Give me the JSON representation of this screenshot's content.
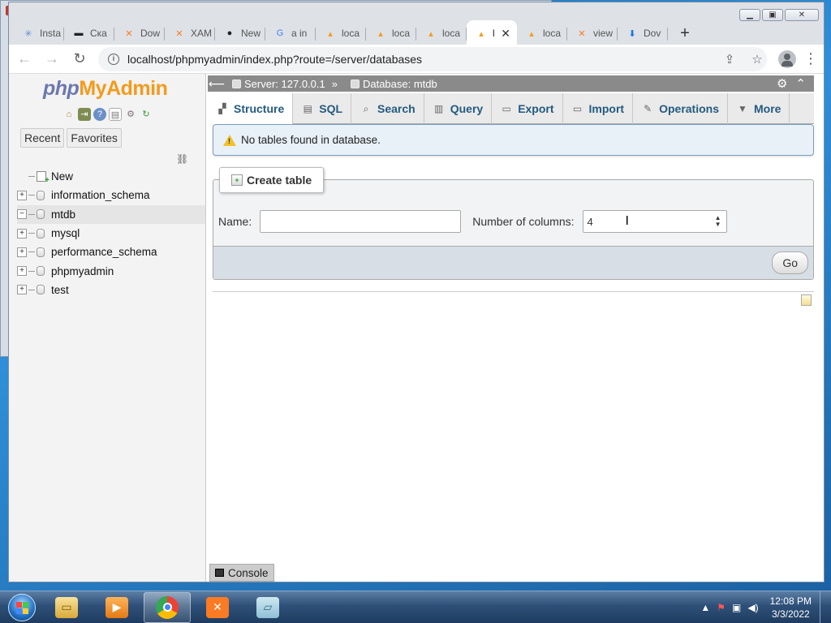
{
  "browser": {
    "tabs": [
      {
        "label": "Insta",
        "icon": "sparkle-icon",
        "color": "#5b8bd6"
      },
      {
        "label": "Ска",
        "icon": "terminal-icon",
        "color": "#222222"
      },
      {
        "label": "Dow",
        "icon": "xampp-icon",
        "color": "#fb7a24"
      },
      {
        "label": "XAM",
        "icon": "xampp-icon",
        "color": "#fb7a24"
      },
      {
        "label": "New",
        "icon": "github-icon",
        "color": "#222222"
      },
      {
        "label": "a in",
        "icon": "google-icon",
        "color": "#4285f4"
      },
      {
        "label": "loca",
        "icon": "phpmyadmin-icon",
        "color": "#f29b1d"
      },
      {
        "label": "loca",
        "icon": "phpmyadmin-icon",
        "color": "#f29b1d"
      },
      {
        "label": "loca",
        "icon": "phpmyadmin-icon",
        "color": "#f29b1d"
      },
      {
        "label": "l",
        "icon": "phpmyadmin-icon",
        "color": "#f29b1d",
        "active": true
      },
      {
        "label": "loca",
        "icon": "phpmyadmin-icon",
        "color": "#f29b1d"
      },
      {
        "label": "view",
        "icon": "xampp-icon",
        "color": "#fb7a24"
      },
      {
        "label": "Dov",
        "icon": "download-icon",
        "color": "#1a73e8"
      }
    ],
    "url": "localhost/phpmyadmin/index.php?route=/server/databases"
  },
  "nav": {
    "logo": {
      "php": "php",
      "my": "My",
      "admin": "Admin"
    },
    "recent": "Recent",
    "favorites": "Favorites",
    "new_label": "New",
    "databases": [
      "information_schema",
      "mtdb",
      "mysql",
      "performance_schema",
      "phpmyadmin",
      "test"
    ],
    "selected": "mtdb"
  },
  "breadcrumb": {
    "server": "Server: 127.0.0.1",
    "separator": "»",
    "database": "Database: mtdb"
  },
  "tabs": [
    {
      "label": "Structure",
      "icon": "structure-icon",
      "active": true
    },
    {
      "label": "SQL",
      "icon": "sql-icon"
    },
    {
      "label": "Search",
      "icon": "search-icon"
    },
    {
      "label": "Query",
      "icon": "query-icon"
    },
    {
      "label": "Export",
      "icon": "export-icon"
    },
    {
      "label": "Import",
      "icon": "import-icon"
    },
    {
      "label": "Operations",
      "icon": "wrench-icon"
    },
    {
      "label": "More",
      "icon": "caret-down-icon"
    }
  ],
  "notice": "No tables found in database.",
  "create_table": {
    "legend": "Create table",
    "name_label": "Name:",
    "name_value": "",
    "columns_label": "Number of columns:",
    "columns_value": "4",
    "go": "Go"
  },
  "console": "Console",
  "taskbar": {
    "time": "12:08 PM",
    "date": "3/3/2022"
  }
}
